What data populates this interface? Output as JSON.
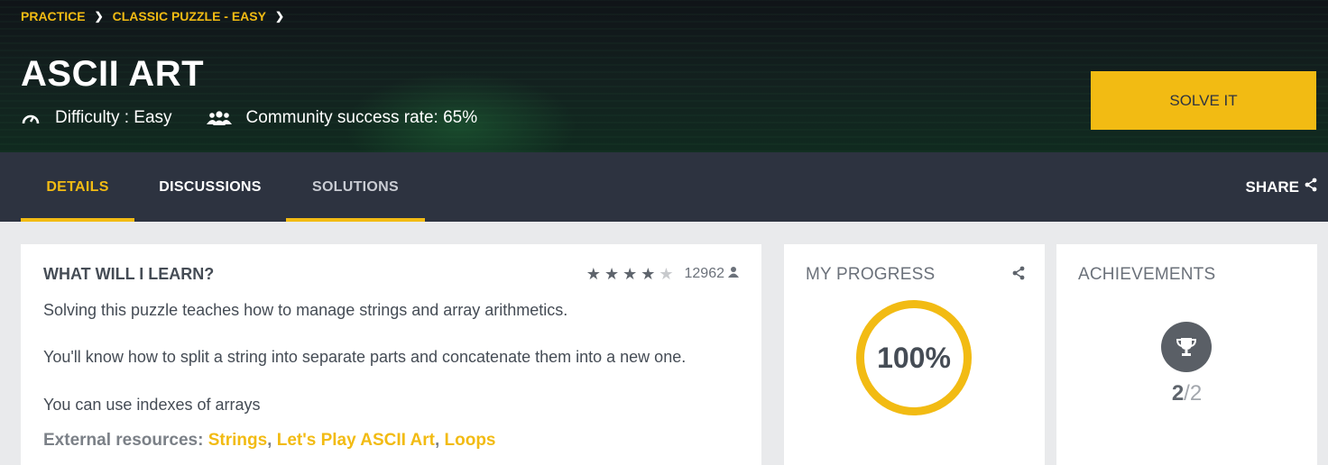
{
  "breadcrumbs": [
    "PRACTICE",
    "CLASSIC PUZZLE - EASY"
  ],
  "title": "ASCII ART",
  "difficulty": "Difficulty : Easy",
  "success_rate": "Community success rate: 65%",
  "solve_label": "SOLVE IT",
  "tabs": [
    {
      "label": "DETAILS",
      "active": true
    },
    {
      "label": "DISCUSSIONS",
      "active": false
    },
    {
      "label": "SOLUTIONS",
      "active": false
    }
  ],
  "share_label": "SHARE",
  "learn": {
    "heading": "WHAT WILL I LEARN?",
    "rating": {
      "stars": 4,
      "max": 5,
      "count": "12962"
    },
    "paragraphs": [
      "Solving this puzzle teaches how to manage strings and array arithmetics.",
      "You'll know how to split a string into separate parts and concatenate them into a new one.",
      "You can use indexes of arrays"
    ],
    "resources_label": "External resources:",
    "resources": [
      "Strings",
      "Let's Play ASCII Art",
      "Loops"
    ]
  },
  "progress": {
    "heading": "MY PROGRESS",
    "value": "100%",
    "fraction": 1.0
  },
  "achievements": {
    "heading": "ACHIEVEMENTS",
    "earned": "2",
    "total": "/2"
  },
  "colors": {
    "accent": "#f2bb13",
    "tabbar": "#2d3340",
    "text": "#454c55"
  },
  "icons": [
    "chevron-right-icon",
    "gauge-icon",
    "users-icon",
    "share-icon",
    "star-icon",
    "user-icon",
    "trophy-icon"
  ]
}
